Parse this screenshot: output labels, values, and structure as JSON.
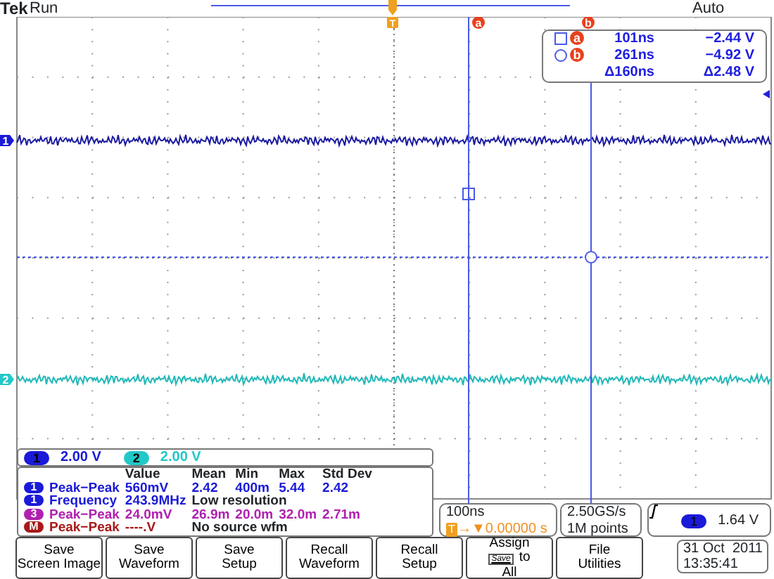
{
  "header": {
    "brand": "Tek",
    "state": "Run",
    "trigger_mode": "Auto"
  },
  "markers": {
    "trigger": "T",
    "cursor_a": "a",
    "cursor_b": "b",
    "ch1": "1",
    "ch2": "2"
  },
  "cursor_readout": {
    "rows": [
      {
        "kind": "square",
        "label": "a",
        "time": "101ns",
        "volts": "−2.44 V"
      },
      {
        "kind": "circle",
        "label": "b",
        "time": "261ns",
        "volts": "−4.92 V"
      },
      {
        "kind": "delta",
        "time": "Δ160ns",
        "volts": "Δ2.48 V"
      }
    ]
  },
  "channel_scales": [
    {
      "channel": "1",
      "value": "2.00 V",
      "color": "#1a1ad8"
    },
    {
      "channel": "2",
      "value": "2.00 V",
      "color": "#22c8c8"
    }
  ],
  "measurements": {
    "columns": [
      "Value",
      "Mean",
      "Min",
      "Max",
      "Std Dev"
    ],
    "rows": [
      {
        "source": "1",
        "color": "#1a1ad8",
        "name": "Peak−Peak",
        "values": [
          "560mV",
          "2.42",
          "400m",
          "5.44",
          "2.42"
        ]
      },
      {
        "source": "1",
        "color": "#1a1ad8",
        "name": "Frequency",
        "values": [
          "243.9MHz"
        ],
        "note": "Low resolution"
      },
      {
        "source": "3",
        "color": "#b020b0",
        "name": "Peak−Peak",
        "values": [
          "24.0mV",
          "26.9m",
          "20.0m",
          "32.0m",
          "2.71m"
        ]
      },
      {
        "source": "M",
        "color": "#a81818",
        "name": "Peak−Peak",
        "values": [
          "----.V"
        ],
        "note": "No source wfm"
      }
    ]
  },
  "horizontal": {
    "scale": "100ns",
    "trigger_marker": "T",
    "delay": "→▼0.00000 s"
  },
  "acquisition": {
    "rate": "2.50GS/s",
    "length": "1M points"
  },
  "trigger": {
    "source": "1",
    "level": "1.64 V"
  },
  "buttons": [
    {
      "kind": "plain",
      "lines": [
        "Save",
        "Screen Image"
      ]
    },
    {
      "kind": "plain",
      "lines": [
        "Save",
        "Waveform"
      ]
    },
    {
      "kind": "plain",
      "lines": [
        "Save",
        "Setup"
      ]
    },
    {
      "kind": "plain",
      "lines": [
        "Recall",
        "Waveform"
      ]
    },
    {
      "kind": "plain",
      "lines": [
        "Recall",
        "Setup"
      ]
    },
    {
      "kind": "assign",
      "lines": [
        "Assign",
        "to",
        "All"
      ],
      "key": "Save"
    },
    {
      "kind": "plain",
      "lines": [
        "File",
        "Utilities"
      ]
    }
  ],
  "date_time": [
    "31 Oct  2011",
    "13:35:41"
  ]
}
